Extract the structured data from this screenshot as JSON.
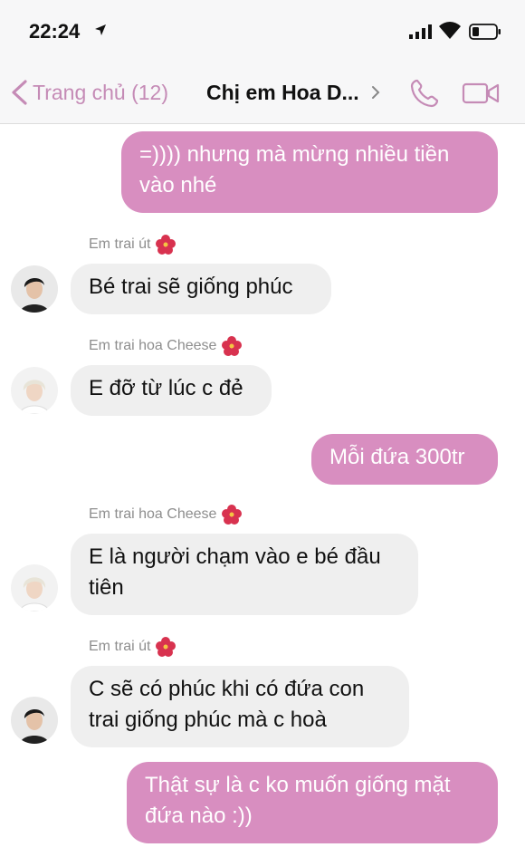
{
  "status_bar": {
    "time": "22:24",
    "icons": [
      "location-arrow-icon",
      "signal-icon",
      "wifi-icon",
      "battery-icon"
    ]
  },
  "nav": {
    "back_label": "Trang chủ (12)",
    "title": "Chị em Hoa D...",
    "accent_color": "#c58bb6"
  },
  "colors": {
    "outgoing_bubble": "#d88ec0",
    "incoming_bubble": "#efefef"
  },
  "messages": [
    {
      "direction": "outgoing",
      "text": "=)))) nhưng mà mừng nhiều tiền vào nhé"
    },
    {
      "direction": "incoming",
      "sender": "Em trai út",
      "text": "Bé trai sẽ giống phúc"
    },
    {
      "direction": "incoming",
      "sender": "Em trai hoa Cheese",
      "text": "E đỡ từ lúc c đẻ"
    },
    {
      "direction": "outgoing",
      "text": "Mỗi đứa 300tr"
    },
    {
      "direction": "incoming",
      "sender": "Em trai hoa Cheese",
      "text": "E là người chạm vào e bé đầu tiên"
    },
    {
      "direction": "incoming",
      "sender": "Em trai út",
      "text": "C sẽ có phúc khi có đứa con trai giống phúc mà c hoà"
    },
    {
      "direction": "outgoing",
      "text": "Thật sự là c ko muốn giống mặt đứa nào :))"
    }
  ]
}
